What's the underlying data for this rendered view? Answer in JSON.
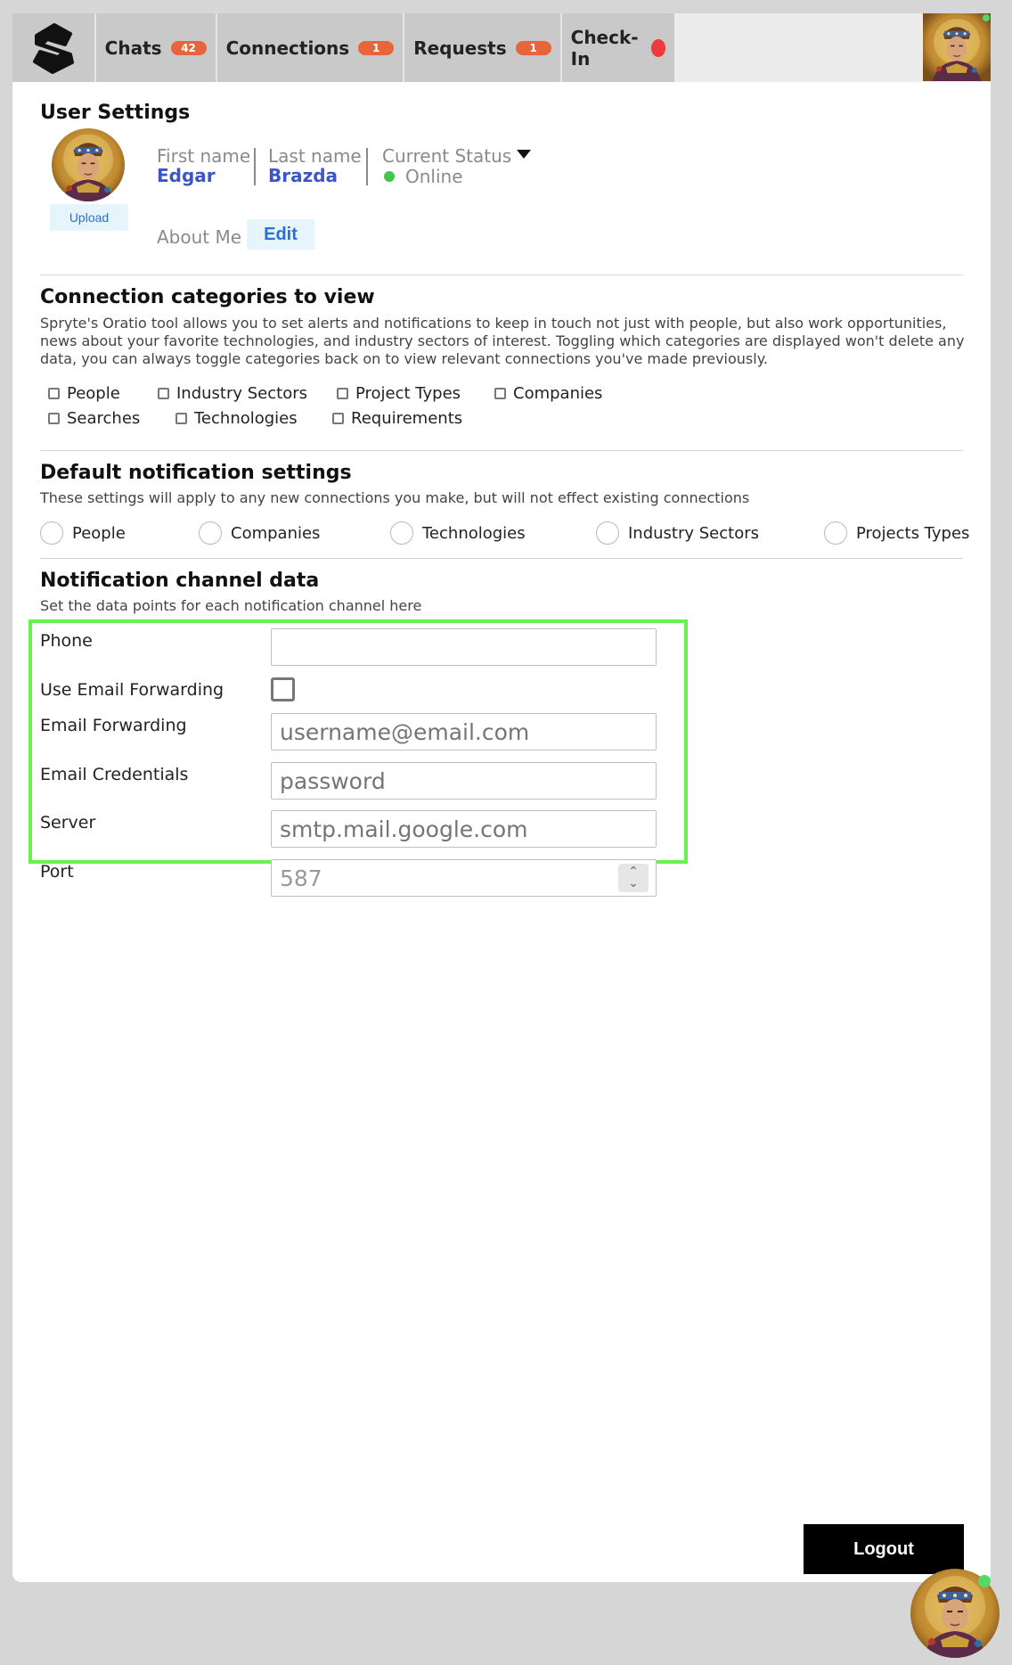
{
  "nav": {
    "logo_icon": "s-logo-icon",
    "items": [
      {
        "label": "Chats",
        "badge": "42"
      },
      {
        "label": "Connections",
        "badge": "1"
      },
      {
        "label": "Requests",
        "badge": "1"
      },
      {
        "label": "Check-In"
      }
    ],
    "checkin_status_color": "#ef3b3b"
  },
  "user_settings": {
    "title": "User Settings",
    "upload_label": "Upload",
    "first_name_label": "First name",
    "first_name": "Edgar",
    "last_name_label": "Last name",
    "last_name": "Brazda",
    "status_label": "Current Status",
    "status_value": "Online",
    "about_label": "About Me",
    "edit_label": "Edit"
  },
  "categories": {
    "title": "Connection categories to view",
    "description": "Spryte's Oratio tool allows you to set alerts and notifications to keep in touch not just with people, but also work opportunities, news about your favorite technologies, and industry sectors of interest. Toggling which categories are displayed won't delete any data, you can always toggle categories back on to view relevant connections you've made previously.",
    "items": [
      "People",
      "Industry Sectors",
      "Project Types",
      "Companies",
      "Searches",
      "Technologies",
      "Requirements"
    ]
  },
  "defaults": {
    "title": "Default notification settings",
    "description": "These settings will apply to any new connections you make, but will not effect existing connections",
    "options": [
      "People",
      "Companies",
      "Technologies",
      "Industry Sectors",
      "Projects Types"
    ]
  },
  "channel": {
    "title": "Notification channel data",
    "description": "Set the data points for each notification channel here",
    "phone_label": "Phone",
    "phone_value": "",
    "forwarding_toggle_label": "Use Email Forwarding",
    "forwarding_label": "Email Forwarding",
    "forwarding_placeholder": "username@email.com",
    "credentials_label": "Email Credentials",
    "credentials_placeholder": "password",
    "server_label": "Server",
    "server_placeholder": "smtp.mail.google.com",
    "port_label": "Port",
    "port_placeholder": "587"
  },
  "logout_label": "Logout",
  "colors": {
    "accent_blue": "#3b56c6",
    "badge_orange": "#e8643a",
    "online_green": "#3fc64d",
    "highlight_frame": "#6bf051"
  }
}
